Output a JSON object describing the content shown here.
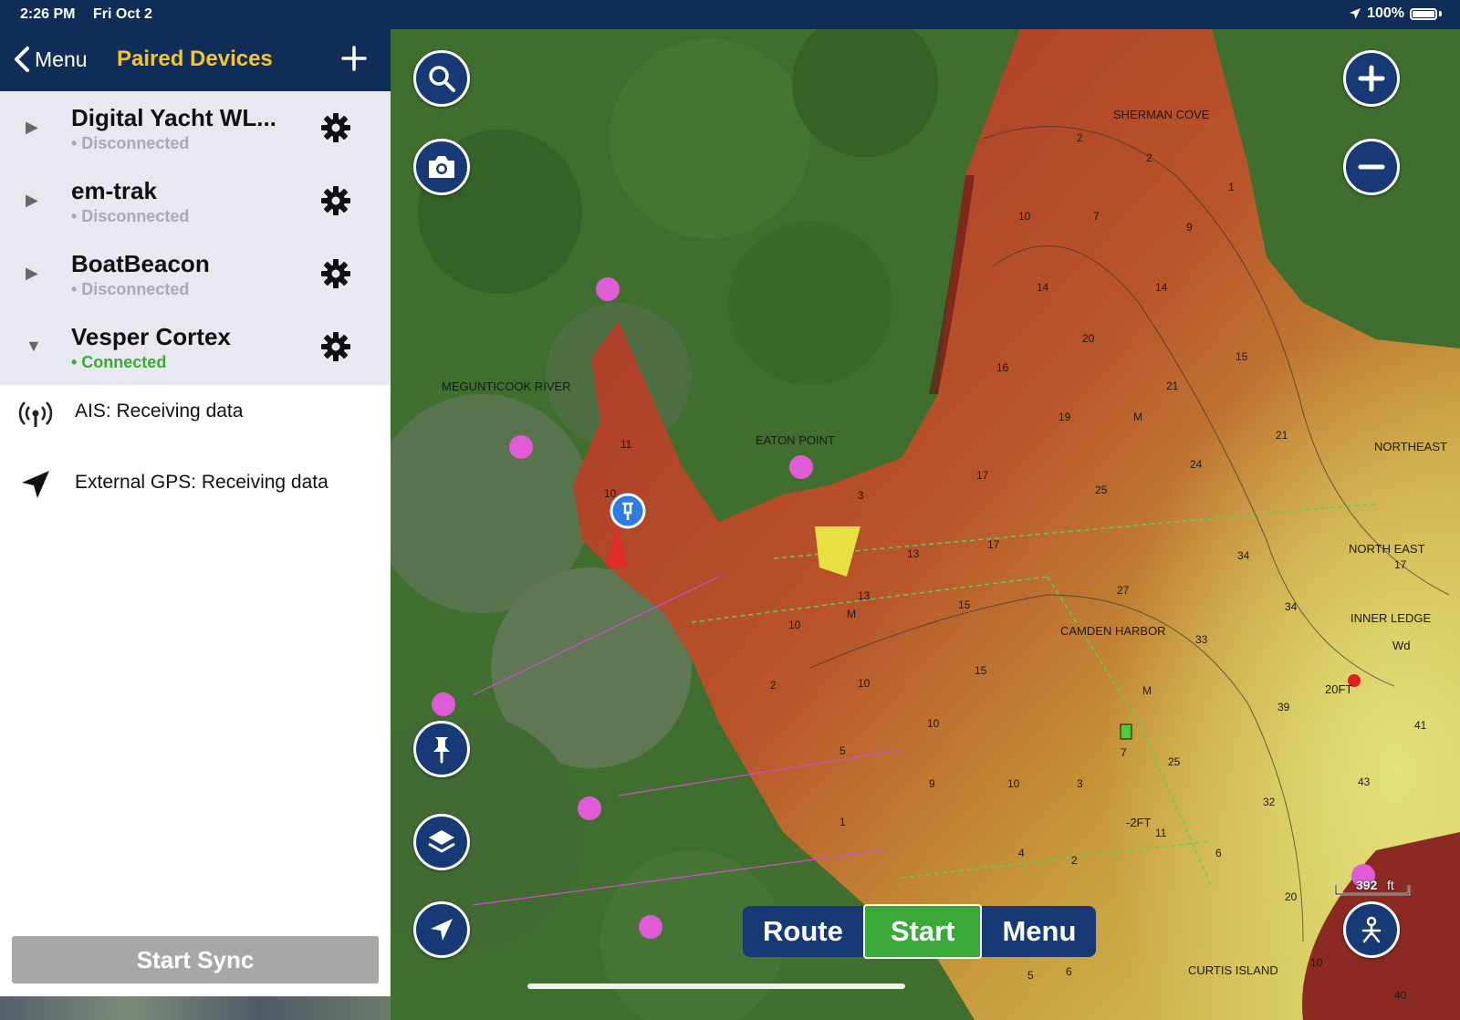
{
  "statusbar": {
    "time": "2:26 PM",
    "date": "Fri Oct 2",
    "battery": "100%"
  },
  "nav": {
    "back_label": "Menu",
    "title": "Paired Devices"
  },
  "devices": [
    {
      "name": "Digital Yacht WL...",
      "status": "• Disconnected",
      "expanded": false
    },
    {
      "name": "em-trak",
      "status": "• Disconnected",
      "expanded": false
    },
    {
      "name": "BoatBeacon",
      "status": "• Disconnected",
      "expanded": false
    },
    {
      "name": "Vesper Cortex",
      "status": "• Connected",
      "expanded": true
    }
  ],
  "subitems": [
    {
      "label": "AIS: Receiving data",
      "icon": "antenna-icon"
    },
    {
      "label": "External GPS: Receiving data",
      "icon": "navigation-arrow-icon"
    }
  ],
  "sync_button": "Start Sync",
  "bottom_bar": {
    "route": "Route",
    "start": "Start",
    "menu": "Menu"
  },
  "scale": {
    "value": "392",
    "unit": "ft"
  },
  "map_labels": {
    "sherman_cove": "SHERMAN COVE",
    "megunticook": "MEGUNTICOOK RIVER",
    "eaton_point": "EATON POINT",
    "camden_harbor": "CAMDEN HARBOR",
    "northeast_top": "NORTHEAST",
    "northeast_mid": "NORTH EAST",
    "inner_ledge": "INNER LEDGE",
    "curtis_island": "CURTIS ISLAND",
    "twenty_ft": "20FT",
    "minus_two_ft": "-2FT",
    "wd": "Wd"
  },
  "soundings": [
    "2",
    "2",
    "1",
    "10",
    "7",
    "9",
    "14",
    "14",
    "20",
    "16",
    "21",
    "15",
    "19",
    "M",
    "21",
    "24",
    "17",
    "25",
    "3",
    "13",
    "17",
    "34",
    "27",
    "34",
    "10",
    "13",
    "15",
    "M",
    "33",
    "2",
    "10",
    "15",
    "M",
    "39",
    "41",
    "10",
    "5",
    "9",
    "10",
    "3",
    "7",
    "25",
    "43",
    "32",
    "1",
    "4",
    "2",
    "11",
    "6",
    "20",
    "5",
    "6",
    "10",
    "40",
    "11",
    "10",
    "17"
  ],
  "colors": {
    "nav_bg": "#0f2d57",
    "title_accent": "#f7c52b",
    "connected": "#3aaa35",
    "start_green": "#3aa93a",
    "button_blue": "#173a77"
  }
}
